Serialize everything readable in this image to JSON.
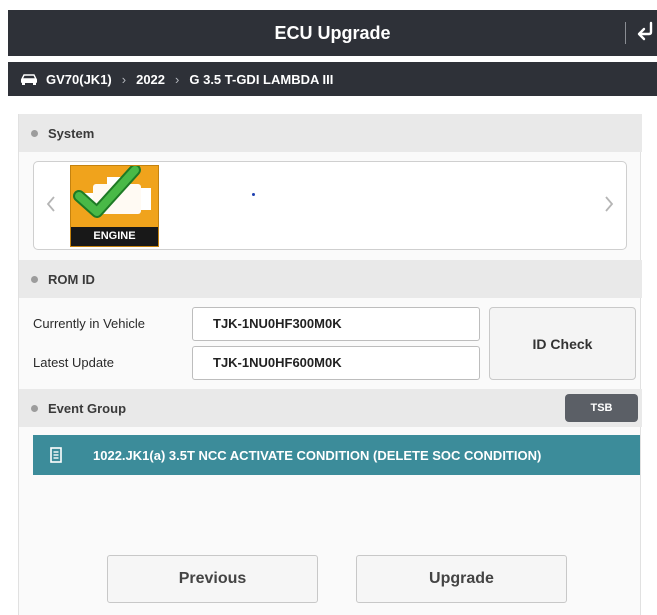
{
  "header": {
    "title": "ECU Upgrade"
  },
  "breadcrumb": {
    "items": [
      "GV70(JK1)",
      "2022",
      "G 3.5 T-GDI LAMBDA III"
    ]
  },
  "system": {
    "section_label": "System",
    "selected_system": "ENGINE"
  },
  "rom_id": {
    "section_label": "ROM ID",
    "current_label": "Currently in Vehicle",
    "current_value": "TJK-1NU0HF300M0K",
    "latest_label": "Latest Update",
    "latest_value": "TJK-1NU0HF600M0K",
    "check_button": "ID Check"
  },
  "event_group": {
    "section_label": "Event Group",
    "tsb_button": "TSB",
    "events": [
      "1022.JK1(a) 3.5T NCC ACTIVATE CONDITION (DELETE SOC CONDITION)"
    ]
  },
  "footer": {
    "previous_label": "Previous",
    "upgrade_label": "Upgrade"
  },
  "colors": {
    "header_bg": "#2e3138",
    "section_bg": "#e9e9e9",
    "event_row_bg": "#3c8c9a",
    "engine_tile": "#f0a31c",
    "check_green": "#49b947"
  },
  "icons": {
    "back": "return-arrow-icon",
    "car": "car-icon",
    "carousel_prev": "chevron-left-icon",
    "carousel_next": "chevron-right-icon",
    "engine": "engine-check-icon",
    "event": "document-icon"
  }
}
